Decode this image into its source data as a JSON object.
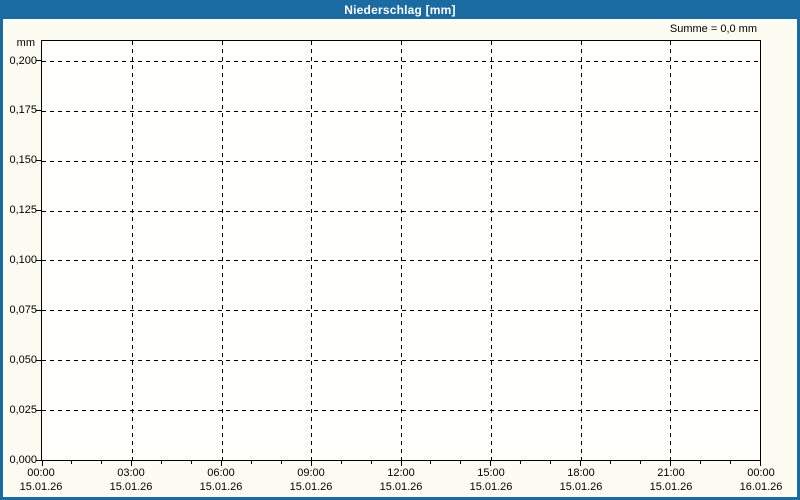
{
  "titlebar": {
    "title": "Niederschlag [mm]"
  },
  "header": {
    "sum_label": "Summe = 0,0 mm"
  },
  "colors": {
    "frame_blue": "#1b6ba3",
    "background": "#fcfcf2",
    "plot_background": "#fefefa",
    "grid": "#000000",
    "title_text": "#ffffff",
    "label_text": "#000000"
  },
  "chart_data": {
    "type": "line",
    "title": "Niederschlag [mm]",
    "xlabel": "",
    "ylabel": "mm",
    "ylim": [
      0,
      0.21
    ],
    "grid": "dashed",
    "legend": "none",
    "sum_text": "Summe = 0,0 mm",
    "sum_value_mm": 0.0,
    "y_ticks": [
      {
        "label": "0,200",
        "value": 0.2
      },
      {
        "label": "0,175",
        "value": 0.175
      },
      {
        "label": "0,150",
        "value": 0.15
      },
      {
        "label": "0,125",
        "value": 0.125
      },
      {
        "label": "0,100",
        "value": 0.1
      },
      {
        "label": "0,075",
        "value": 0.075
      },
      {
        "label": "0,050",
        "value": 0.05
      },
      {
        "label": "0,025",
        "value": 0.025
      },
      {
        "label": "0,000",
        "value": 0.0
      }
    ],
    "x_ticks": [
      {
        "time": "00:00",
        "date": "15.01.26"
      },
      {
        "time": "03:00",
        "date": "15.01.26"
      },
      {
        "time": "06:00",
        "date": "15.01.26"
      },
      {
        "time": "09:00",
        "date": "15.01.26"
      },
      {
        "time": "12:00",
        "date": "15.01.26"
      },
      {
        "time": "15:00",
        "date": "15.01.26"
      },
      {
        "time": "18:00",
        "date": "15.01.26"
      },
      {
        "time": "21:00",
        "date": "15.01.26"
      },
      {
        "time": "00:00",
        "date": "16.01.26"
      }
    ],
    "x_tick_interval_hours": 3,
    "x_minor_tick_interval_hours": 1,
    "series": [
      {
        "name": "Niederschlag",
        "values": []
      }
    ]
  }
}
